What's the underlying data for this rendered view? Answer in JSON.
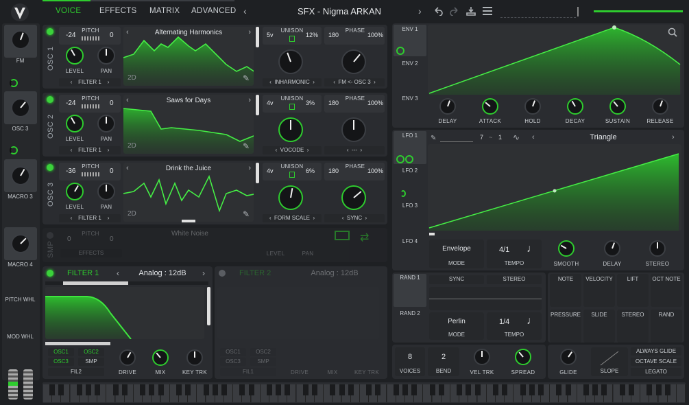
{
  "header": {
    "tabs": [
      "VOICE",
      "EFFECTS",
      "MATRIX",
      "ADVANCED"
    ],
    "active_tab": "VOICE",
    "preset_name": "SFX - Nigma ARKAN"
  },
  "sidebar": {
    "slots": [
      {
        "label": "FM"
      },
      {
        "label": "OSC 3"
      },
      {
        "label": "MACRO 3"
      },
      {
        "label": "MACRO 4"
      }
    ],
    "wheels": [
      "PITCH WHL",
      "MOD WHL"
    ]
  },
  "oscillators": [
    {
      "title": "OSC 1",
      "pitch_semis": "-24",
      "pitch_label": "PITCH",
      "pitch_cents": "0",
      "wavetable": "Alternating Harmonics",
      "dim": "2D",
      "level_label": "LEVEL",
      "pan_label": "PAN",
      "route": "FILTER 1",
      "unison_voices": "5v",
      "unison_label": "UNISON",
      "unison_detune": "12%",
      "phase_deg": "180",
      "phase_label": "PHASE",
      "phase_rand": "100%",
      "spectral": "INHARMONIC",
      "distortion": "FM <- OSC 3"
    },
    {
      "title": "OSC 2",
      "pitch_semis": "-24",
      "pitch_label": "PITCH",
      "pitch_cents": "0",
      "wavetable": "Saws for Days",
      "dim": "2D",
      "level_label": "LEVEL",
      "pan_label": "PAN",
      "route": "FILTER 1",
      "unison_voices": "4v",
      "unison_label": "UNISON",
      "unison_detune": "3%",
      "phase_deg": "180",
      "phase_label": "PHASE",
      "phase_rand": "100%",
      "spectral": "VOCODE",
      "distortion": "---"
    },
    {
      "title": "OSC 3",
      "pitch_semis": "-36",
      "pitch_label": "PITCH",
      "pitch_cents": "0",
      "wavetable": "Drink the Juice",
      "dim": "2D",
      "level_label": "LEVEL",
      "pan_label": "PAN",
      "route": "FILTER 1",
      "unison_voices": "4v",
      "unison_label": "UNISON",
      "unison_detune": "6%",
      "phase_deg": "180",
      "phase_label": "PHASE",
      "phase_rand": "100%",
      "spectral": "FORM SCALE",
      "distortion": "SYNC"
    }
  ],
  "sample": {
    "title": "SMP",
    "pitch_semis": "0",
    "pitch_label": "PITCH",
    "pitch_cents": "0",
    "name": "White Noise",
    "route": "EFFECTS",
    "level_label": "LEVEL",
    "pan_label": "PAN"
  },
  "filter1": {
    "title": "FILTER 1",
    "model": "Analog",
    "slope": "12dB",
    "sources": [
      "OSC1",
      "OSC2",
      "OSC3",
      "SMP"
    ],
    "source_active": [
      "OSC1",
      "OSC2"
    ],
    "route": "FIL2",
    "knobs": [
      "DRIVE",
      "MIX",
      "KEY TRK"
    ]
  },
  "filter2": {
    "title": "FILTER 2",
    "model": "Analog",
    "slope": "12dB",
    "sources": [
      "OSC1",
      "OSC2",
      "OSC3",
      "SMP"
    ],
    "route": "FIL1",
    "knobs": [
      "DRIVE",
      "MIX",
      "KEY TRK"
    ]
  },
  "envelopes": {
    "tabs": [
      "ENV 1",
      "ENV 2",
      "ENV 3"
    ],
    "knobs": [
      "DELAY",
      "ATTACK",
      "HOLD",
      "DECAY",
      "SUSTAIN",
      "RELEASE"
    ]
  },
  "lfos": {
    "tabs": [
      "LFO 1",
      "LFO 2",
      "LFO 3",
      "LFO 4"
    ],
    "grid_x": "7",
    "grid_y": "1",
    "shape": "Triangle",
    "mode": "Envelope",
    "mode_label": "MODE",
    "tempo": "4/1",
    "tempo_label": "TEMPO",
    "knobs": [
      "SMOOTH",
      "DELAY",
      "STEREO"
    ]
  },
  "randoms": {
    "tabs": [
      "RAND 1",
      "RAND 2"
    ],
    "sync": "SYNC",
    "stereo": "STEREO",
    "mode": "Perlin",
    "mode_label": "MODE",
    "tempo": "1/4",
    "tempo_label": "TEMPO"
  },
  "mod_sources": [
    "NOTE",
    "VELOCITY",
    "LIFT",
    "OCT NOTE",
    "PRESSURE",
    "SLIDE",
    "STEREO",
    "RAND"
  ],
  "voice": {
    "voices": "8",
    "voices_label": "VOICES",
    "bend": "2",
    "bend_label": "BEND",
    "vel_trk": "VEL TRK",
    "spread": "SPREAD",
    "glide": "GLIDE",
    "slope": "SLOPE",
    "options": [
      "ALWAYS GLIDE",
      "OCTAVE SCALE",
      "LEGATO"
    ]
  },
  "colors": {
    "accent": "#2ecc2e",
    "bg": "#1e2023",
    "panel": "#2a2c30"
  },
  "icons": [
    "vital-logo-icon",
    "undo-icon",
    "redo-icon",
    "save-icon",
    "menu-icon",
    "search-icon",
    "pencil-icon",
    "shuffle-icon",
    "note-icon"
  ]
}
